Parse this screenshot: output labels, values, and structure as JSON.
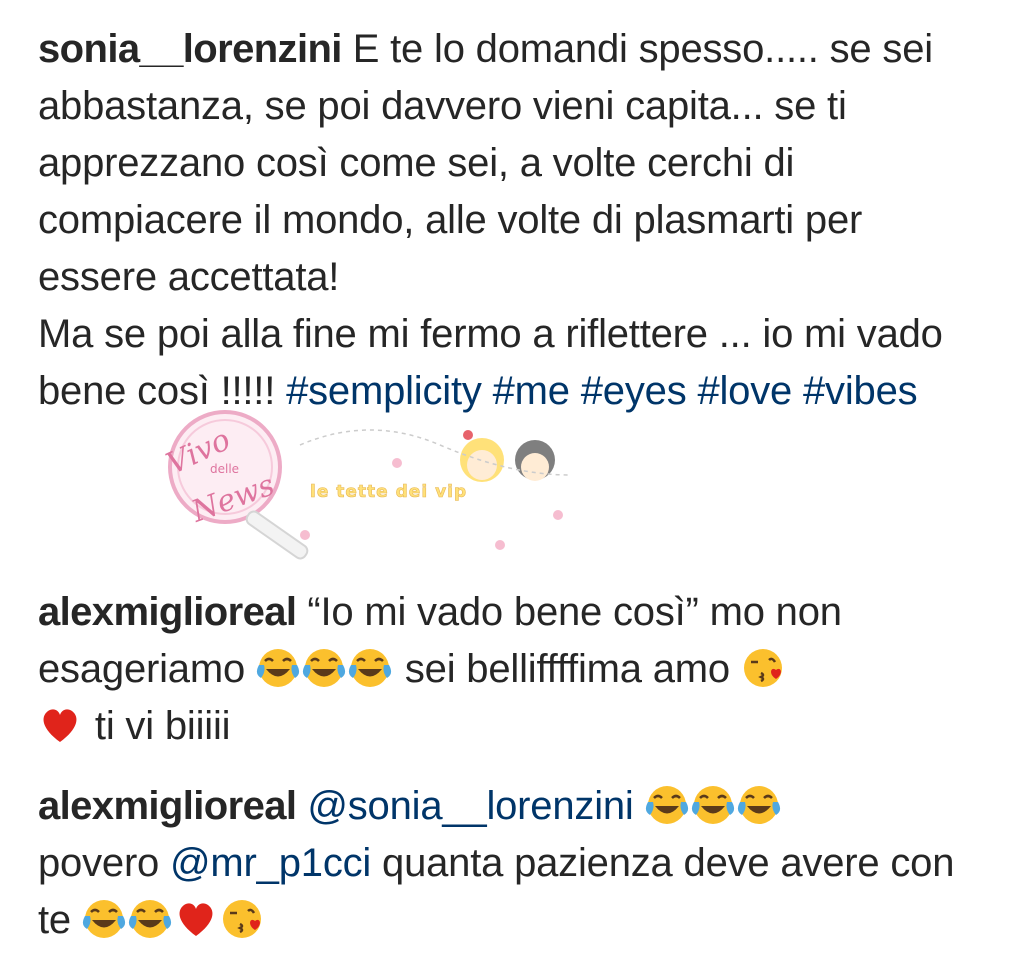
{
  "comments": [
    {
      "username": "sonia__lorenzini",
      "text_1": "E te lo domandi spesso..... se sei abbastanza, se poi davvero vieni capita... se ti apprezzano così come sei, a volte cerchi di compiacere il mondo, alle volte di plasmarti per essere accettata!",
      "text_2": "Ma se poi alla fine mi fermo a riflettere ... io mi vado bene così !!!!! ",
      "hashtags": [
        "#semplicity",
        "#me",
        "#eyes",
        "#love",
        "#vibes"
      ]
    },
    {
      "username": "alexmiglioreal",
      "text_1": "“Io mi vado bene così” mo non esageriamo",
      "text_2": "sei belliffffima amo",
      "text_3": "ti vi biiiii"
    },
    {
      "username": "alexmiglioreal",
      "mention_1": "@sonia__lorenzini",
      "text_1": "povero",
      "mention_2": "@mr_p1cci",
      "text_2": "quanta pazienza deve avere con te"
    }
  ],
  "watermarks": {
    "left_line1": "Vivo",
    "left_line2": "delle",
    "left_line3": "News",
    "right": "le tette dei vip"
  },
  "icons": {
    "laugh": "face-with-tears-of-joy-icon",
    "kiss": "face-blowing-kiss-icon",
    "heart": "red-heart-icon"
  },
  "colors": {
    "text": "#262626",
    "link": "#003569",
    "emoji_yellow": "#fbc02d",
    "emoji_blue": "#4fa8e0",
    "heart_red": "#e0241b"
  }
}
